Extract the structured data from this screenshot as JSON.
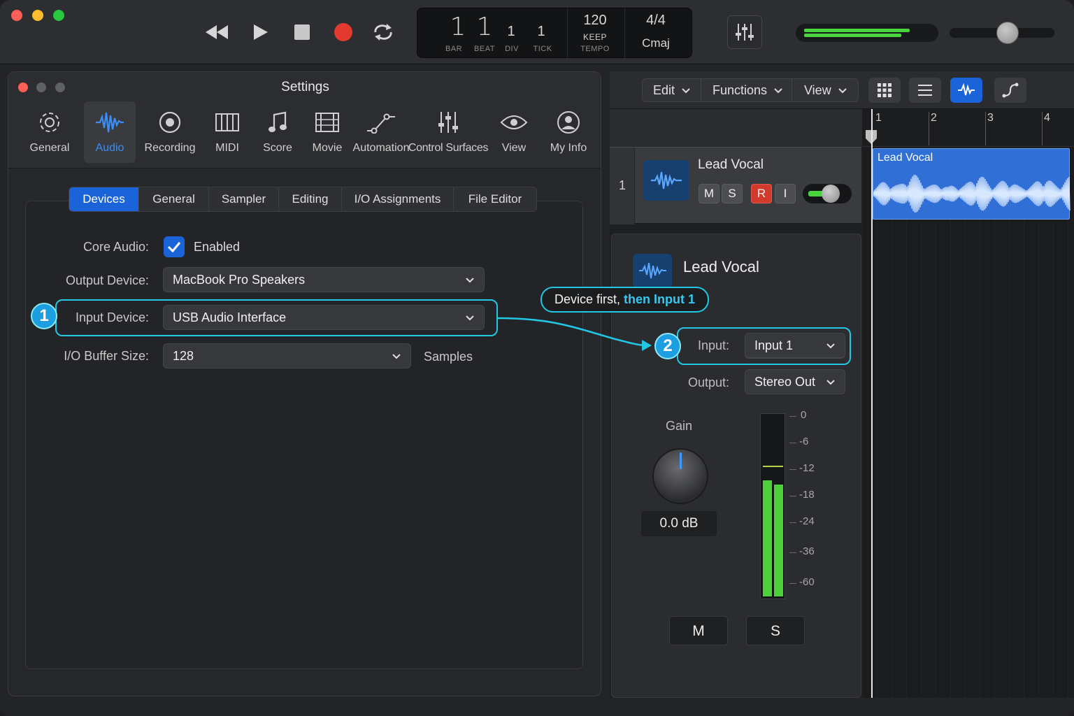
{
  "transport": {
    "bar": "1",
    "beat": "1",
    "div": "1",
    "tick": "1",
    "bar_label": "BAR",
    "beat_label": "BEAT",
    "div_label": "DIV",
    "tick_label": "TICK",
    "tempo": "120",
    "tempo_mode": "KEEP",
    "tempo_label": "TEMPO",
    "signature": "4/4",
    "key": "Cmaj",
    "master_volume_level": 0.47,
    "meter_level": 0.84
  },
  "settings": {
    "title": "Settings",
    "prefs": [
      {
        "label": "General",
        "icon": "gear-icon"
      },
      {
        "label": "Audio",
        "icon": "waveform-icon"
      },
      {
        "label": "Recording",
        "icon": "record-circle-icon"
      },
      {
        "label": "MIDI",
        "icon": "midi-keys-icon"
      },
      {
        "label": "Score",
        "icon": "music-note-icon"
      },
      {
        "label": "Movie",
        "icon": "film-icon"
      },
      {
        "label": "Automation",
        "icon": "automation-curve-icon"
      },
      {
        "label": "Control Surfaces",
        "icon": "faders-icon"
      },
      {
        "label": "View",
        "icon": "eye-icon"
      },
      {
        "label": "My Info",
        "icon": "user-icon"
      }
    ],
    "selected_pref": "Audio",
    "subtabs": [
      "Devices",
      "General",
      "Sampler",
      "Editing",
      "I/O Assignments",
      "File Editor"
    ],
    "selected_subtab": "Devices",
    "core_audio_label": "Core Audio:",
    "core_audio_value": "Enabled",
    "output_label": "Output Device:",
    "output_value": "MacBook Pro Speakers",
    "input_label": "Input Device:",
    "input_value": "USB Audio Interface",
    "buffer_label": "I/O Buffer Size:",
    "buffer_value": "128",
    "buffer_unit": "Samples"
  },
  "callouts": {
    "step1": "1",
    "step2": "2",
    "tip_prefix": "Device first, ",
    "tip_highlight": "then Input 1"
  },
  "arrange": {
    "menus": [
      "Edit",
      "Functions",
      "View"
    ],
    "ruler": [
      "1",
      "2",
      "3",
      "4"
    ],
    "track_number": "1",
    "track_name": "Lead Vocal",
    "track_buttons": [
      "M",
      "S",
      "R",
      "I"
    ],
    "region_name": "Lead Vocal"
  },
  "inspector": {
    "title": "Lead Vocal",
    "input_label": "Input:",
    "input_value": "Input 1",
    "output_label": "Output:",
    "output_value": "Stereo Out",
    "gain_label": "Gain",
    "gain_value": "0.0 dB",
    "meter_scale": [
      "0",
      "-6",
      "-12",
      "-18",
      "-24",
      "-36",
      "-60"
    ],
    "mute": "M",
    "solo": "S"
  },
  "colors": {
    "accent": "#1a63d8",
    "callout": "#22c8e3",
    "record": "#e23a2e",
    "meter_green": "#4cd13a",
    "region": "#2f6fd6"
  }
}
